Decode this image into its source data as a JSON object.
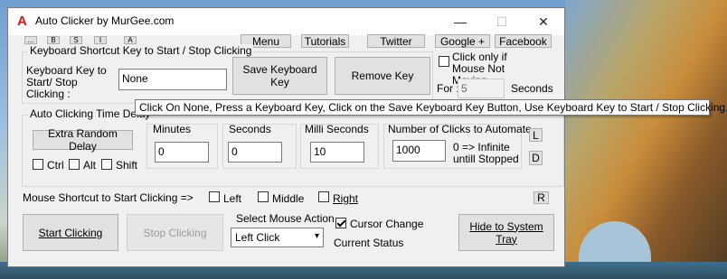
{
  "window": {
    "title": "Auto Clicker by MurGee.com",
    "icon_glyph": "A",
    "minimize_glyph": "—",
    "maximize_glyph": "☐",
    "close_glyph": "✕"
  },
  "mini_buttons": [
    "...",
    "B",
    "S",
    "I",
    "A"
  ],
  "toolbar": {
    "menu": "Menu",
    "tutorials": "Tutorials",
    "twitter": "Twitter",
    "google": "Google +",
    "facebook": "Facebook"
  },
  "keyboard_shortcut": {
    "group_title": "Keyboard Shortcut Key to Start / Stop Clicking",
    "label": "Keyboard Key to Start/ Stop Clicking :",
    "value": "None",
    "save_button": "Save Keyboard Key",
    "remove_button": "Remove Key",
    "click_only_label": "Click only if Mouse Not Moving",
    "for_label": "For :",
    "for_value": "5",
    "seconds_label": "Seconds"
  },
  "tooltip": "Click On None, Press a Keyboard Key, Click on the Save Keyboard Key Button, Use Keyboard Key to Start / Stop Clicking.",
  "timing": {
    "group_title": "Auto Clicking Time Delay",
    "extra_random_delay": "Extra Random Delay",
    "ctrl_label": "Ctrl",
    "alt_label": "Alt",
    "shift_label": "Shift",
    "minutes_label": "Minutes",
    "minutes_value": "0",
    "seconds_label": "Seconds",
    "seconds_value": "0",
    "milli_label": "Milli Seconds",
    "milli_value": "10",
    "clicks_label": "Number of Clicks to Automate",
    "clicks_value": "1000",
    "infinite_note": "0 => Infinite untill Stopped",
    "l_button": "L",
    "d_button": "D"
  },
  "mouse_shortcut": {
    "label": "Mouse Shortcut to Start Clicking =>",
    "left": "Left",
    "middle": "Middle",
    "right": "Right",
    "r_button": "R"
  },
  "actions": {
    "start": "Start Clicking",
    "stop": "Stop Clicking",
    "select_mouse_action_label": "Select Mouse Action",
    "mouse_action_value": "Left Click",
    "cursor_change_label": "Cursor Change",
    "current_status_label": "Current Status",
    "hide_tray": "Hide to System Tray"
  }
}
